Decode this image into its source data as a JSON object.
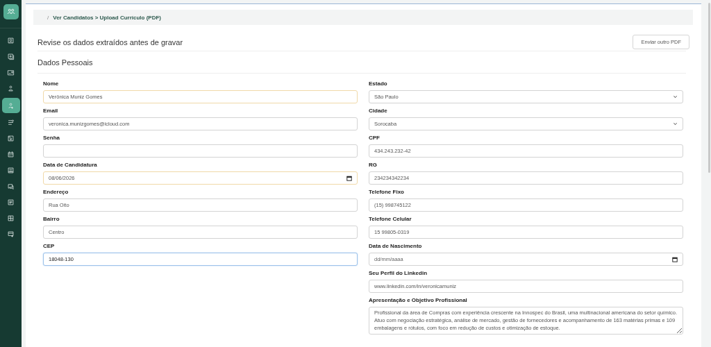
{
  "sidebar": {
    "items": [
      {
        "selected": false
      },
      {
        "selected": false
      },
      {
        "selected": false
      },
      {
        "selected": false
      },
      {
        "selected": true
      },
      {
        "selected": false
      },
      {
        "selected": false
      },
      {
        "selected": false
      },
      {
        "selected": false
      },
      {
        "selected": false
      },
      {
        "selected": false
      },
      {
        "selected": false
      },
      {
        "selected": false
      }
    ]
  },
  "breadcrumb": {
    "separator": "/",
    "path": "Ver Candidatos > Upload Currículo (PDF)"
  },
  "header": {
    "title": "Revise os dados extraídos antes de gravar",
    "button": "Enviar outro PDF"
  },
  "section": {
    "title": "Dados Pessoais"
  },
  "left_fields": [
    {
      "kind": "text",
      "label": "Nome",
      "value": "Verônica Muniz Gomes",
      "highlighted": true,
      "focused": false
    },
    {
      "kind": "text",
      "label": "Email",
      "value": "veronica.munizgomes@icloud.com",
      "highlighted": false,
      "focused": false
    },
    {
      "kind": "text",
      "label": "Senha",
      "highlighted": false,
      "focused": false
    },
    {
      "kind": "date",
      "label": "Data de Candidatura",
      "value": "08/06/2026",
      "highlighted": true,
      "focused": false
    },
    {
      "kind": "text",
      "label": "Endereço",
      "value": "Rua Oito",
      "highlighted": false,
      "focused": false
    },
    {
      "kind": "text",
      "label": "Bairro",
      "value": "Centro",
      "highlighted": false,
      "focused": false
    },
    {
      "kind": "text",
      "label": "CEP",
      "value": "18048-130",
      "highlighted": false,
      "focused": true
    }
  ],
  "right_fields": [
    {
      "kind": "select",
      "label": "Estado",
      "value": "São Paulo",
      "highlighted": false,
      "focused": false
    },
    {
      "kind": "select",
      "label": "Cidade",
      "value": "Sorocaba",
      "highlighted": false,
      "focused": false
    },
    {
      "kind": "text",
      "label": "CPF",
      "value": "434.243.232-42",
      "highlighted": false,
      "focused": false
    },
    {
      "kind": "text",
      "label": "RG",
      "value": "234234342234",
      "highlighted": false,
      "focused": false
    },
    {
      "kind": "text",
      "label": "Telefone Fixo",
      "value": "(15) 998745122",
      "highlighted": false,
      "focused": false
    },
    {
      "kind": "text",
      "label": "Telefone Celular",
      "value": "15 99805-0319",
      "highlighted": false,
      "focused": false
    },
    {
      "kind": "date",
      "label": "Data de Nascimento",
      "placeholder": "dd/mm/aaaa",
      "highlighted": false,
      "focused": false
    },
    {
      "kind": "text",
      "label": "Seu Perfil do Linkedin",
      "value": "www.linkedin.com/in/veronicamuniz",
      "highlighted": false,
      "focused": false
    },
    {
      "kind": "textarea",
      "label": "Apresentação e Objetivo Profissional",
      "value": "Profissional da área de Compras com experiência crescente na Innospec do Brasil, uma multinacional americana do setor químico. Atuo com negociação estratégica, análise de mercado, gestão de fornecedores e acompanhamento de 163 matérias primas e 109 embalagens e rótulos, com foco em redução de custos e otimização de estoque.",
      "highlighted": false,
      "focused": false
    }
  ]
}
